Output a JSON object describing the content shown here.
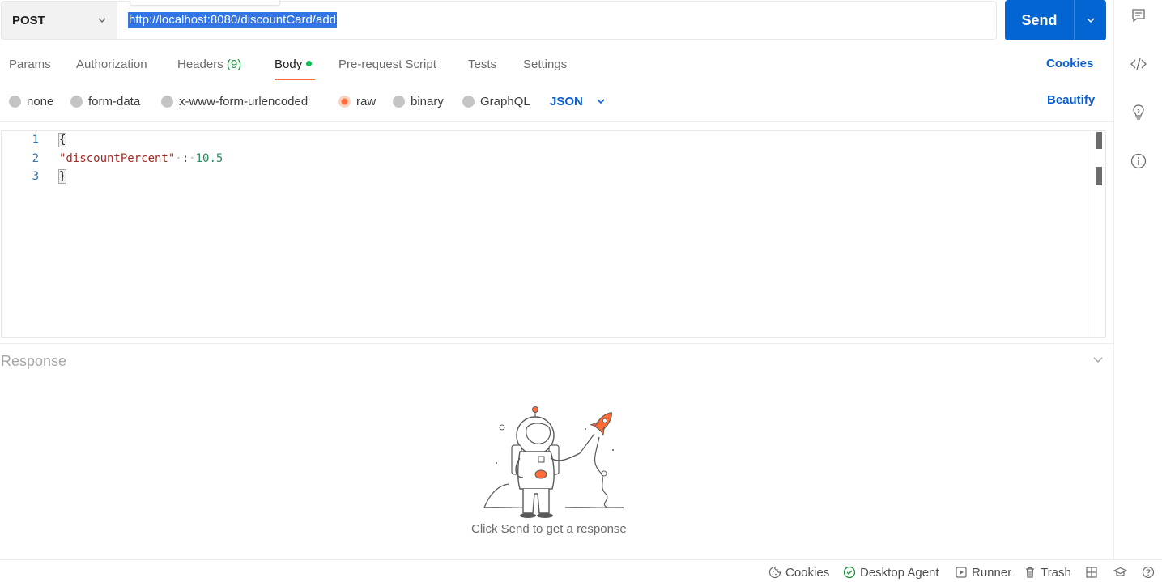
{
  "request": {
    "method": "POST",
    "url": "http://localhost:8080/discountCard/add",
    "send_label": "Send"
  },
  "tabs": [
    {
      "label": "Params"
    },
    {
      "label": "Authorization"
    },
    {
      "label": "Headers",
      "count": "(9)"
    },
    {
      "label": "Body",
      "active": true
    },
    {
      "label": "Pre-request Script"
    },
    {
      "label": "Tests"
    },
    {
      "label": "Settings"
    }
  ],
  "cookies_label": "Cookies",
  "body_types": [
    "none",
    "form-data",
    "x-www-form-urlencoded",
    "raw",
    "binary",
    "GraphQL"
  ],
  "selected_body_type": "raw",
  "format": "JSON",
  "beautify_label": "Beautify",
  "editor": {
    "line_numbers": [
      "1",
      "2",
      "3"
    ],
    "open_brace": "{",
    "key": "\"discountPercent\"",
    "colon": ":",
    "value": "10.5",
    "close_brace": "}"
  },
  "response": {
    "title": "Response",
    "hint": "Click Send to get a response"
  },
  "statusbar": {
    "cookies": "Cookies",
    "desktop_agent": "Desktop Agent",
    "runner": "Runner",
    "trash": "Trash"
  },
  "colors": {
    "accent_orange": "#ff6c37",
    "send_blue": "#0265d2",
    "link_blue": "#0b5fd1",
    "url_selection": "#3276e6"
  },
  "icons": {
    "sidebar": [
      "comments-icon",
      "code-icon",
      "lightbulb-icon",
      "info-icon"
    ],
    "statusbar": [
      "cookie-icon",
      "check-circle-icon",
      "play-icon",
      "trash-icon",
      "layout-icon",
      "bootcamp-icon",
      "help-icon"
    ]
  }
}
